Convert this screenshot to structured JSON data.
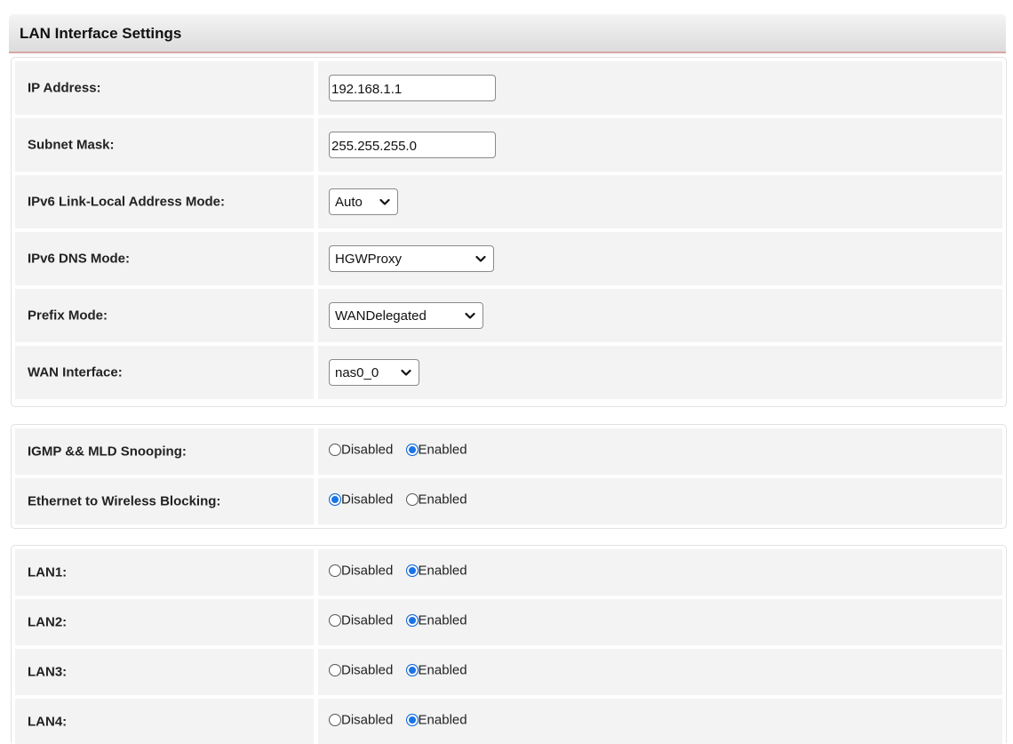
{
  "header": {
    "title": "LAN Interface Settings"
  },
  "lan_settings": {
    "ip_address": {
      "label": "IP Address:",
      "value": "192.168.1.1"
    },
    "subnet_mask": {
      "label": "Subnet Mask:",
      "value": "255.255.255.0"
    },
    "ipv6_link_local_mode": {
      "label": "IPv6 Link-Local Address Mode:",
      "value": "Auto"
    },
    "ipv6_dns_mode": {
      "label": "IPv6 DNS Mode:",
      "value": "HGWProxy"
    },
    "prefix_mode": {
      "label": "Prefix Mode:",
      "value": "WANDelegated"
    },
    "wan_interface": {
      "label": "WAN Interface:",
      "value": "nas0_0"
    }
  },
  "radio_labels": {
    "disabled": "Disabled",
    "enabled": "Enabled"
  },
  "snooping": {
    "igmp_mld": {
      "label": "IGMP && MLD Snooping:",
      "selected": "Enabled"
    },
    "eth_wireless_blocking": {
      "label": "Ethernet to Wireless Blocking:",
      "selected": "Disabled"
    }
  },
  "lan_ports": [
    {
      "label": "LAN1:",
      "selected": "Enabled"
    },
    {
      "label": "LAN2:",
      "selected": "Enabled"
    },
    {
      "label": "LAN3:",
      "selected": "Enabled"
    },
    {
      "label": "LAN4:",
      "selected": "Enabled"
    }
  ],
  "colors": {
    "radio_selected": "#1a73e8",
    "header_underline": "#d8a6a6",
    "row_bg": "#f3f3f3"
  }
}
